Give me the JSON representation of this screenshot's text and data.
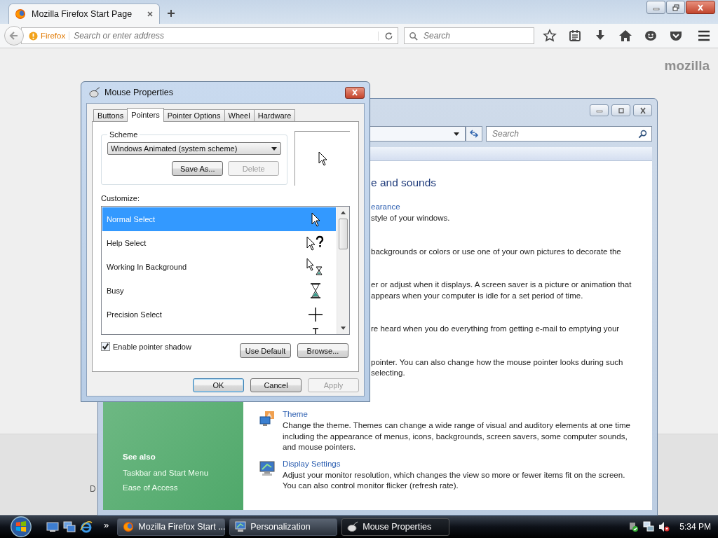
{
  "browser": {
    "tabs": [
      {
        "title": "Mozilla Firefox Start Page",
        "selected": true
      }
    ],
    "identity_label": "Firefox",
    "address": {
      "placeholder": "Search or enter address"
    },
    "search": {
      "placeholder": "Search"
    },
    "page": {
      "logo": "mozilla",
      "edge_text": "D"
    }
  },
  "personalization": {
    "search": {
      "placeholder": "Search"
    },
    "clipped_groups": [
      {
        "kind": "heading",
        "lines": [
          "e and sounds"
        ]
      },
      {
        "kind": "link",
        "link": "earance",
        "lines": [
          "style of your windows."
        ]
      },
      {
        "kind": "text",
        "lines": [
          "backgrounds or colors or use one of your own pictures to decorate the"
        ]
      },
      {
        "kind": "text",
        "lines": [
          "er or adjust when it displays. A screen saver is a picture or animation that",
          "appears when your computer is idle for a set period of time."
        ]
      },
      {
        "kind": "text",
        "lines": [
          "re heard when you do everything from getting e-mail to emptying your"
        ]
      },
      {
        "kind": "text",
        "lines": [
          "pointer. You can also change how the mouse pointer looks during such",
          "selecting."
        ]
      }
    ],
    "sections": [
      {
        "kind": "theme",
        "title": "Theme",
        "description": "Change the theme. Themes can change a wide range of visual and auditory elements at one time including the appearance of menus, icons, backgrounds, screen savers, some computer sounds, and mouse pointers."
      },
      {
        "kind": "display",
        "title": "Display Settings",
        "description": "Adjust your monitor resolution, which changes the view so more or fewer items fit on the screen. You can also control monitor flicker (refresh rate)."
      }
    ],
    "see_also": {
      "heading": "See also",
      "links": [
        "Taskbar and Start Menu",
        "Ease of Access"
      ]
    }
  },
  "dialog": {
    "title": "Mouse Properties",
    "tabs": [
      {
        "label": "Buttons",
        "selected": false
      },
      {
        "label": "Pointers",
        "selected": true
      },
      {
        "label": "Pointer Options",
        "selected": false
      },
      {
        "label": "Wheel",
        "selected": false
      },
      {
        "label": "Hardware",
        "selected": false
      }
    ],
    "scheme": {
      "label": "Scheme",
      "value": "Windows Animated (system scheme)",
      "buttons": [
        {
          "label": "Save As...",
          "disabled": false
        },
        {
          "label": "Delete",
          "disabled": true
        }
      ]
    },
    "customize_label": "Customize:",
    "pointers": [
      {
        "kind": "arrow",
        "name": "Normal Select",
        "selected": true
      },
      {
        "kind": "help",
        "name": "Help Select",
        "selected": false
      },
      {
        "kind": "working",
        "name": "Working In Background",
        "selected": false
      },
      {
        "kind": "busy",
        "name": "Busy",
        "selected": false
      },
      {
        "kind": "cross",
        "name": "Precision Select",
        "selected": false
      },
      {
        "kind": "ibeam",
        "selected": false
      }
    ],
    "shadow": {
      "label": "Enable pointer shadow",
      "checked": true
    },
    "list_buttons": [
      {
        "label": "Use Default",
        "disabled": false
      },
      {
        "label": "Browse...",
        "disabled": false
      }
    ],
    "footer_buttons": [
      {
        "label": "OK",
        "default": true,
        "disabled": false
      },
      {
        "label": "Cancel",
        "default": false,
        "disabled": false
      },
      {
        "label": "Apply",
        "default": false,
        "disabled": true
      }
    ]
  },
  "taskbar": {
    "overflow": "»",
    "tasks": [
      {
        "kind": "browser",
        "label": "Mozilla Firefox Start ...",
        "selected": false
      },
      {
        "kind": "display",
        "label": "Personalization",
        "selected": false
      },
      {
        "kind": "mouse",
        "label": "Mouse Properties",
        "selected": true
      }
    ],
    "clock": "5:34 PM"
  }
}
